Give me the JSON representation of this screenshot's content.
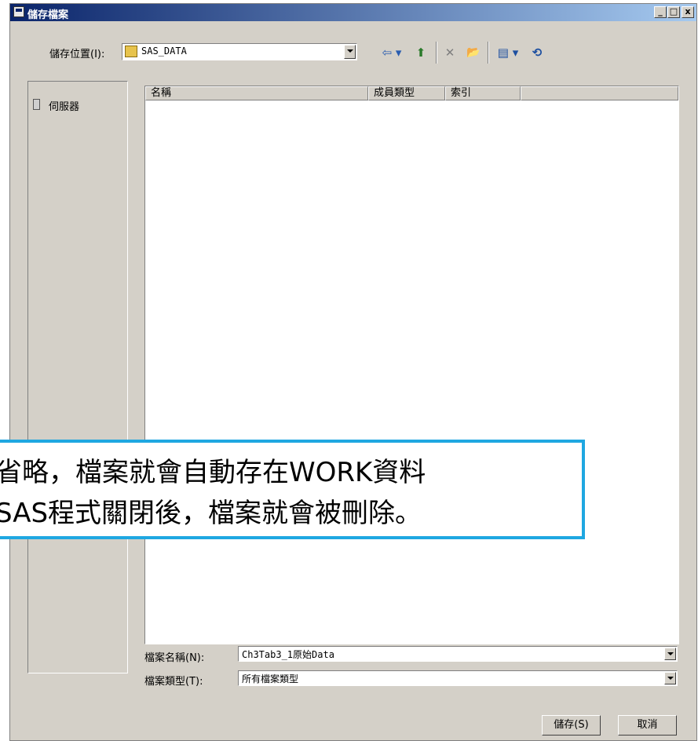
{
  "window": {
    "title": "儲存檔案",
    "controls": {
      "minimize": "_",
      "maximize": "□",
      "close": "x"
    }
  },
  "location": {
    "label": "儲存位置(I):",
    "value": "SAS_DATA"
  },
  "toolbar": {
    "icons": [
      "back-arrow-icon",
      "up-folder-icon",
      "delete-icon",
      "new-folder-icon",
      "views-icon",
      "refresh-icon"
    ],
    "back_glyph": "⇦ ▾",
    "up_glyph": "⬆",
    "delete_glyph": "✕",
    "newfolder_glyph": "📂",
    "views_glyph": "▤ ▾",
    "refresh_glyph": "⟲"
  },
  "places": {
    "items": [
      {
        "label": "伺服器",
        "icon": "server-icon"
      }
    ]
  },
  "list": {
    "columns": [
      "名稱",
      "成員類型",
      "索引"
    ],
    "rows": []
  },
  "filename": {
    "label": "檔案名稱(N):",
    "value": "Ch3Tab3_1原始Data"
  },
  "filetype": {
    "label": "檔案類型(T):",
    "value": "所有檔案類型"
  },
  "buttons": {
    "save": "儲存(S)",
    "cancel": "取消"
  },
  "callout": {
    "line1": "省略，檔案就會自動存在WORK資料",
    "line2": "SAS程式關閉後，檔案就會被刪除。",
    "border_color": "#1fa7e1"
  }
}
